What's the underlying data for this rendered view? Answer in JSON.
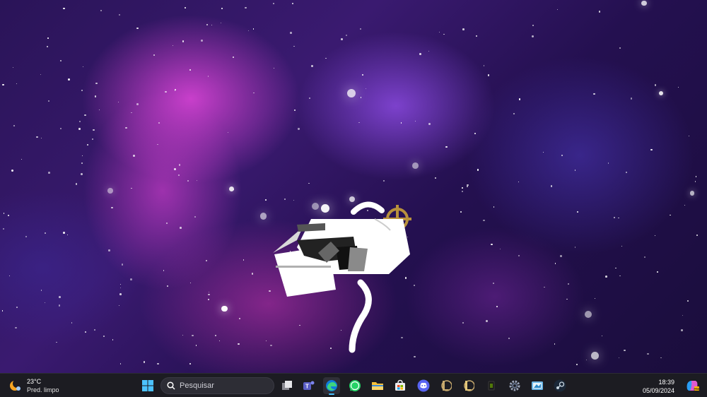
{
  "desktop": {
    "wallpaper": "galaxy-nebula-wallpaper",
    "sprite": "white-pixel-creature-sprite"
  },
  "taskbar": {
    "weather": {
      "icon": "weather-moon-icon",
      "temperature": "23°C",
      "description": "Pred. limpo"
    },
    "search": {
      "placeholder": "Pesquisar"
    },
    "apps": [
      {
        "name": "start",
        "icon": "windows-start-icon"
      },
      {
        "name": "task-view",
        "icon": "task-view-icon"
      },
      {
        "name": "teams",
        "icon": "teams-icon"
      },
      {
        "name": "edge",
        "icon": "edge-icon",
        "active": true
      },
      {
        "name": "whatsapp",
        "icon": "whatsapp-icon"
      },
      {
        "name": "file-explorer",
        "icon": "folder-icon"
      },
      {
        "name": "store",
        "icon": "store-icon"
      },
      {
        "name": "discord",
        "icon": "discord-icon"
      },
      {
        "name": "league-client-1",
        "icon": "league-icon"
      },
      {
        "name": "league-client-2",
        "icon": "league-icon"
      },
      {
        "name": "nvidia",
        "icon": "nvidia-icon"
      },
      {
        "name": "settings",
        "icon": "gear-icon"
      },
      {
        "name": "snipping-tool",
        "icon": "snipping-icon"
      },
      {
        "name": "steam",
        "icon": "steam-icon"
      }
    ],
    "clock": {
      "time": "18:39",
      "date": "05/09/2024"
    },
    "copilot": {
      "icon": "copilot-icon"
    },
    "accent": "#4cc2ff"
  }
}
